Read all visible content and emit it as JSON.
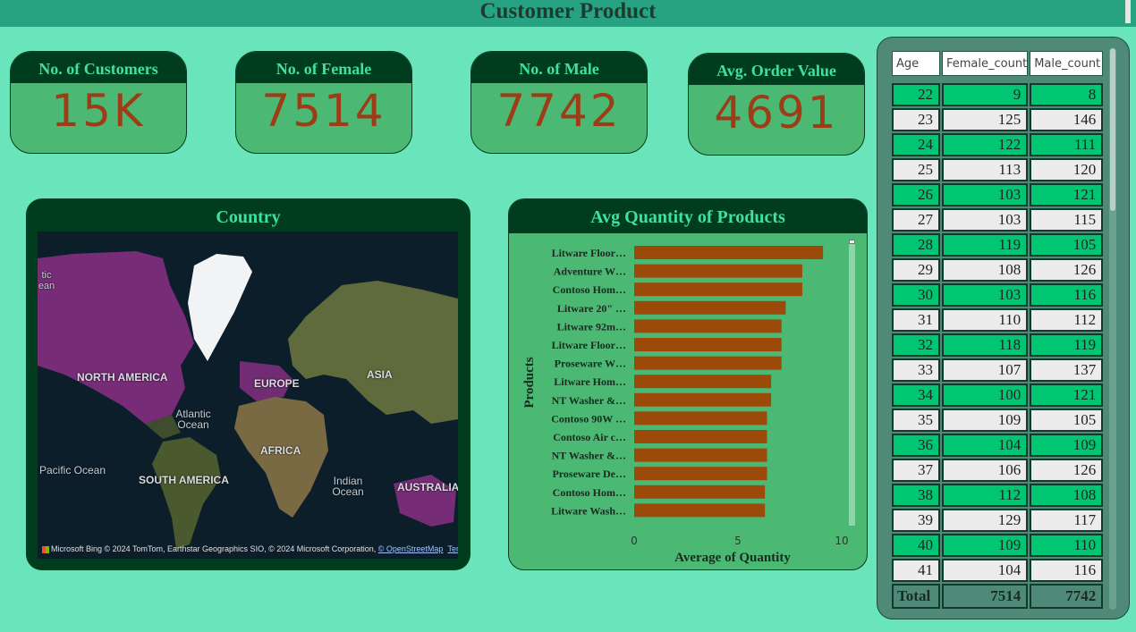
{
  "page": {
    "title": "Customer Product"
  },
  "kpis": [
    {
      "label": "No. of Customers",
      "value": "15K"
    },
    {
      "label": "No. of Female",
      "value": "7514"
    },
    {
      "label": "No. of Male",
      "value": "7742"
    },
    {
      "label": "Avg. Order Value",
      "value": "4691"
    }
  ],
  "map": {
    "title": "Country",
    "labels": {
      "north_america": "NORTH AMERICA",
      "europe": "EUROPE",
      "asia": "ASIA",
      "africa": "AFRICA",
      "south_america": "SOUTH AMERICA",
      "australia": "AUSTRALIA",
      "atlantic": "Atlantic Ocean",
      "pacific": "Pacific Ocean",
      "indian": "Indian Ocean",
      "arctic_partial": "tic ean"
    },
    "attribution": "Microsoft Bing  © 2024 TomTom, Earthstar Geographics SIO, © 2024 Microsoft Corporation, ",
    "osm_link": "© OpenStreetMap",
    "terms_link": "Terms",
    "highlight_color": "#8b2f86"
  },
  "chart_data": {
    "type": "bar",
    "orientation": "horizontal",
    "title": "Avg Quantity of Products",
    "xlabel": "Average of Quantity",
    "ylabel": "Products",
    "categories": [
      "Litware Floor…",
      "Adventure W…",
      "Contoso Hom…",
      "Litware 20\" …",
      "Litware 92m…",
      "Litware Floor…",
      "Proseware W…",
      "Litware Hom…",
      "NT Washer &…",
      "Contoso 90W …",
      "Contoso Air c…",
      "NT Washer &…",
      "Proseware De…",
      "Contoso Hom…",
      "Litware Wash…"
    ],
    "values": [
      9.1,
      8.1,
      8.1,
      7.3,
      7.1,
      7.1,
      7.1,
      6.6,
      6.6,
      6.4,
      6.4,
      6.4,
      6.4,
      6.3,
      6.3
    ],
    "xlim": [
      0,
      10
    ],
    "xticks": [
      "0",
      "5",
      "10"
    ],
    "bar_color": "#9c4a0a",
    "grid": false
  },
  "table": {
    "headers": [
      "Age",
      "Female_count",
      "Male_count"
    ],
    "rows": [
      [
        "22",
        "9",
        "8"
      ],
      [
        "23",
        "125",
        "146"
      ],
      [
        "24",
        "122",
        "111"
      ],
      [
        "25",
        "113",
        "120"
      ],
      [
        "26",
        "103",
        "121"
      ],
      [
        "27",
        "103",
        "115"
      ],
      [
        "28",
        "119",
        "105"
      ],
      [
        "29",
        "108",
        "126"
      ],
      [
        "30",
        "103",
        "116"
      ],
      [
        "31",
        "110",
        "112"
      ],
      [
        "32",
        "118",
        "119"
      ],
      [
        "33",
        "107",
        "137"
      ],
      [
        "34",
        "100",
        "121"
      ],
      [
        "35",
        "109",
        "105"
      ],
      [
        "36",
        "104",
        "109"
      ],
      [
        "37",
        "106",
        "126"
      ],
      [
        "38",
        "112",
        "108"
      ],
      [
        "39",
        "129",
        "117"
      ],
      [
        "40",
        "109",
        "110"
      ],
      [
        "41",
        "104",
        "116"
      ]
    ],
    "total": [
      "Total",
      "7514",
      "7742"
    ]
  }
}
